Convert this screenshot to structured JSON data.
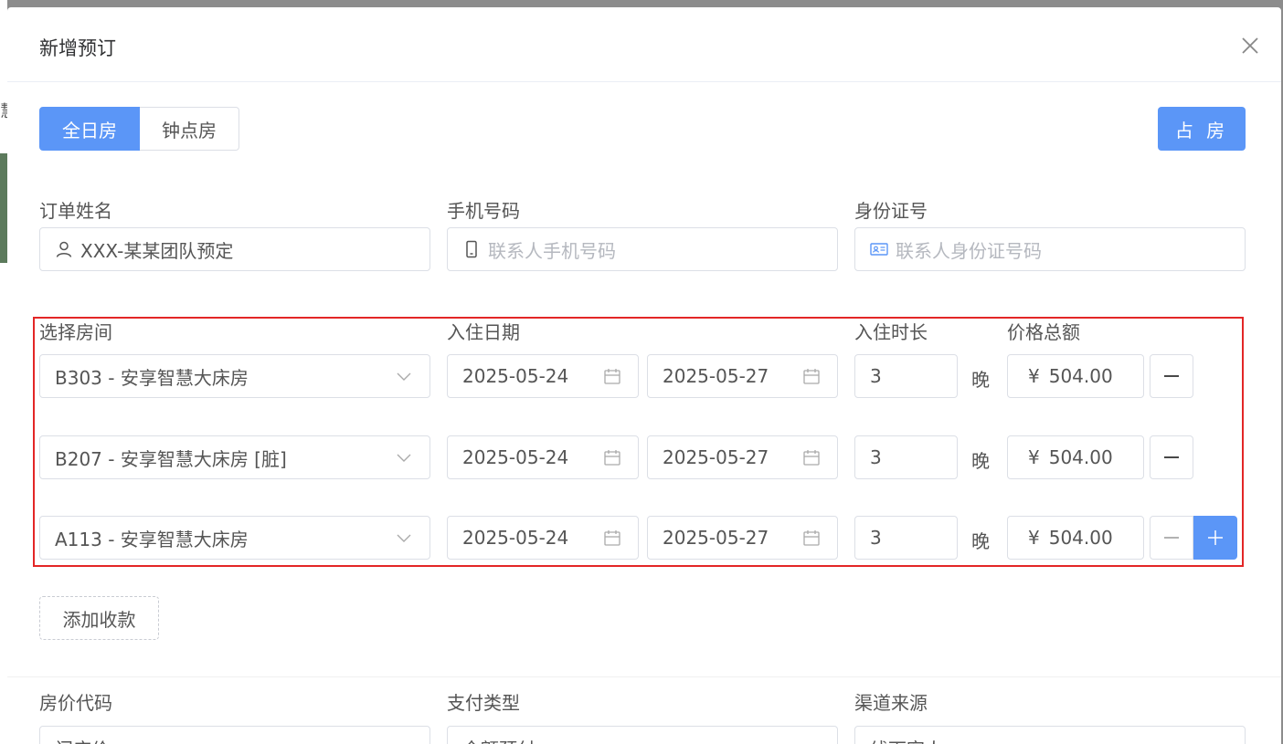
{
  "modal": {
    "title": "新增预订"
  },
  "tabs": [
    {
      "label": "全日房",
      "active": true
    },
    {
      "label": "钟点房",
      "active": false
    }
  ],
  "occupy_button": "占 房",
  "contact": {
    "name_label": "订单姓名",
    "name_value": "XXX-某某团队预定",
    "phone_label": "手机号码",
    "phone_placeholder": "联系人手机号码",
    "id_label": "身份证号",
    "id_placeholder": "联系人身份证号码"
  },
  "rooms": {
    "room_label": "选择房间",
    "date_label": "入住日期",
    "duration_label": "入住时长",
    "price_label": "价格总额",
    "night_unit": "晚",
    "currency": "¥",
    "items": [
      {
        "room": "B303 - 安享智慧大床房",
        "checkin": "2025-05-24",
        "checkout": "2025-05-27",
        "nights": "3",
        "price": "504.00"
      },
      {
        "room": "B207 - 安享智慧大床房 [脏]",
        "checkin": "2025-05-24",
        "checkout": "2025-05-27",
        "nights": "3",
        "price": "504.00"
      },
      {
        "room": "A113 - 安享智慧大床房",
        "checkin": "2025-05-24",
        "checkout": "2025-05-27",
        "nights": "3",
        "price": "504.00"
      }
    ]
  },
  "add_payment": "添加收款",
  "bottom": {
    "rate_label": "房价代码",
    "rate_value": "门店价",
    "pay_label": "支付类型",
    "pay_value": "全额预付",
    "channel_label": "渠道来源",
    "channel_value": "线下客人"
  },
  "colors": {
    "primary": "#5b96f7",
    "highlight": "#e32626"
  }
}
